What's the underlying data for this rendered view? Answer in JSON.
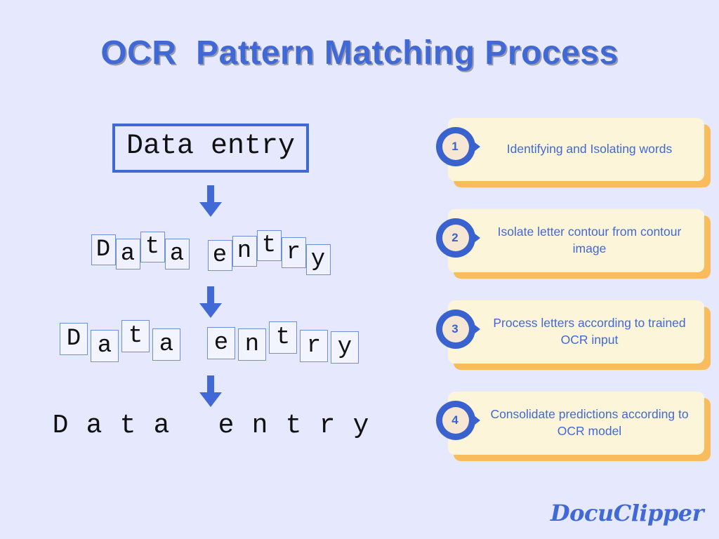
{
  "title": "OCR  Pattern Matching Process",
  "colors": {
    "background": "#e6e9fd",
    "accent_blue": "#4169d6",
    "card_fill": "#fcf5da",
    "card_shadow": "#f9bc5c",
    "letter_box_border": "#6f8fd8",
    "title_shadow": "#9a9aa8"
  },
  "flow": {
    "row1": {
      "text": "Data entry"
    },
    "row2": {
      "letters": [
        "D",
        "a",
        "t",
        "a",
        " ",
        "e",
        "n",
        "t",
        "r",
        "y"
      ],
      "offsets": [
        0,
        6,
        -4,
        6,
        0,
        8,
        2,
        -6,
        4,
        14
      ]
    },
    "row3": {
      "letters": [
        "D",
        "a",
        "t",
        "a",
        " ",
        "e",
        "n",
        "t",
        "r",
        "y"
      ],
      "offsets": [
        0,
        10,
        -4,
        8,
        0,
        6,
        8,
        -2,
        10,
        12
      ]
    },
    "row4": {
      "letters": [
        "D",
        "a",
        "t",
        "a",
        " ",
        "e",
        "n",
        "t",
        "r",
        "y"
      ]
    },
    "arrow_icon": "arrow-down-icon"
  },
  "steps": [
    {
      "number": "1",
      "text": "Identifying and Isolating words"
    },
    {
      "number": "2",
      "text": "Isolate letter contour from contour image"
    },
    {
      "number": "3",
      "text": "Process letters according to trained OCR input"
    },
    {
      "number": "4",
      "text": "Consolidate predictions according to OCR model"
    }
  ],
  "logo": {
    "text": "DocuClipper"
  }
}
